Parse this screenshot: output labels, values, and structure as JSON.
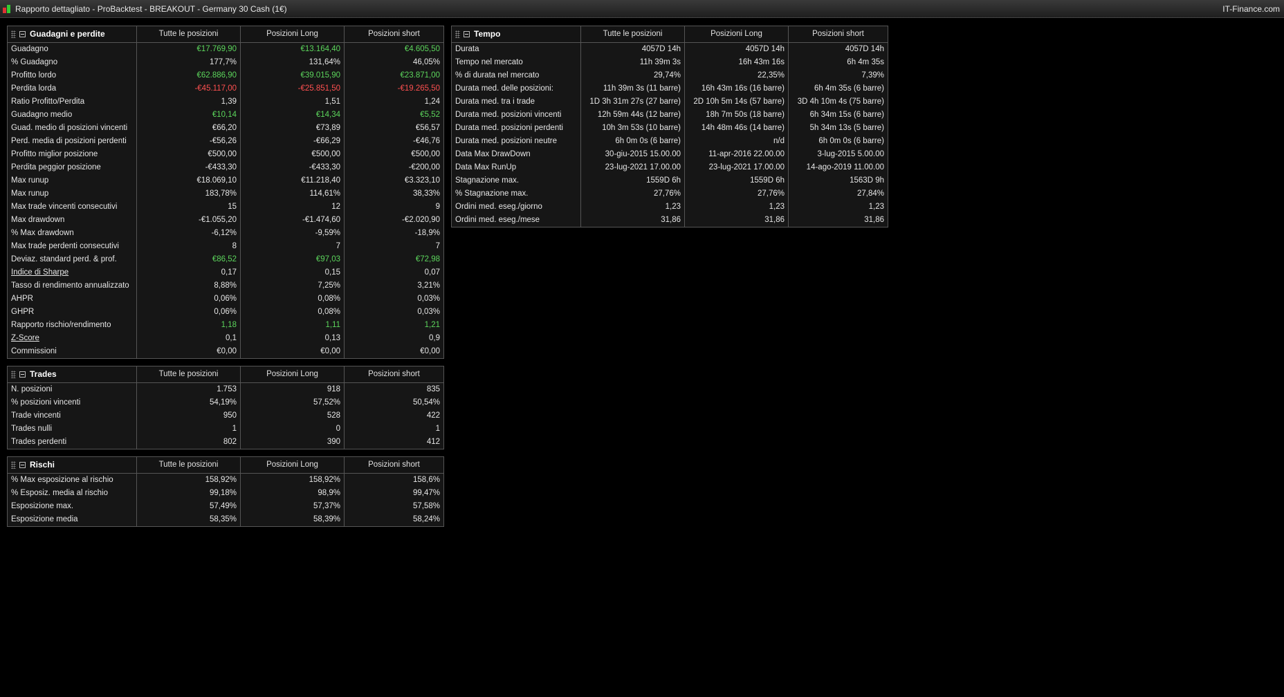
{
  "window": {
    "title": "Rapporto dettagliato - ProBacktest - BREAKOUT - Germany 30 Cash (1€)",
    "brand": "IT-Finance.com"
  },
  "colors": {
    "positive": "#5cd65c",
    "negative": "#ff5050",
    "background": "#000000"
  },
  "columns": [
    "Tutte le posizioni",
    "Posizioni Long",
    "Posizioni short"
  ],
  "panels": {
    "guadagni": {
      "title": "Guadagni e perdite",
      "rows": [
        {
          "label": "Guadagno",
          "values": [
            "€17.769,90",
            "€13.164,40",
            "€4.605,50"
          ],
          "style": "pos"
        },
        {
          "label": "% Guadagno",
          "values": [
            "177,7%",
            "131,64%",
            "46,05%"
          ]
        },
        {
          "label": "Profitto lordo",
          "values": [
            "€62.886,90",
            "€39.015,90",
            "€23.871,00"
          ],
          "style": "pos"
        },
        {
          "label": "Perdita lorda",
          "values": [
            "-€45.117,00",
            "-€25.851,50",
            "-€19.265,50"
          ],
          "style": "neg"
        },
        {
          "label": "Ratio Profitto/Perdita",
          "values": [
            "1,39",
            "1,51",
            "1,24"
          ]
        },
        {
          "label": "Guadagno medio",
          "values": [
            "€10,14",
            "€14,34",
            "€5,52"
          ],
          "style": "pos"
        },
        {
          "label": "Guad. medio di posizioni vincenti",
          "values": [
            "€66,20",
            "€73,89",
            "€56,57"
          ]
        },
        {
          "label": "Perd. media di posizioni perdenti",
          "values": [
            "-€56,26",
            "-€66,29",
            "-€46,76"
          ]
        },
        {
          "label": "Profitto miglior posizione",
          "values": [
            "€500,00",
            "€500,00",
            "€500,00"
          ]
        },
        {
          "label": "Perdita peggior posizione",
          "values": [
            "-€433,30",
            "-€433,30",
            "-€200,00"
          ]
        },
        {
          "label": "Max runup",
          "values": [
            "€18.069,10",
            "€11.218,40",
            "€3.323,10"
          ]
        },
        {
          "label": "Max runup",
          "values": [
            "183,78%",
            "114,61%",
            "38,33%"
          ]
        },
        {
          "label": "Max trade vincenti consecutivi",
          "values": [
            "15",
            "12",
            "9"
          ]
        },
        {
          "label": "Max drawdown",
          "values": [
            "-€1.055,20",
            "-€1.474,60",
            "-€2.020,90"
          ]
        },
        {
          "label": "% Max drawdown",
          "values": [
            "-6,12%",
            "-9,59%",
            "-18,9%"
          ]
        },
        {
          "label": "Max trade perdenti consecutivi",
          "values": [
            "8",
            "7",
            "7"
          ]
        },
        {
          "label": "Deviaz. standard perd. & prof.",
          "values": [
            "€86,52",
            "€97,03",
            "€72,98"
          ],
          "style": "pos"
        },
        {
          "label": "Indice di Sharpe",
          "values": [
            "0,17",
            "0,15",
            "0,07"
          ],
          "underline": true
        },
        {
          "label": "Tasso di rendimento annualizzato",
          "values": [
            "8,88%",
            "7,25%",
            "3,21%"
          ]
        },
        {
          "label": "AHPR",
          "values": [
            "0,06%",
            "0,08%",
            "0,03%"
          ]
        },
        {
          "label": "GHPR",
          "values": [
            "0,06%",
            "0,08%",
            "0,03%"
          ]
        },
        {
          "label": "Rapporto rischio/rendimento",
          "values": [
            "1,18",
            "1,11",
            "1,21"
          ],
          "style": "pos"
        },
        {
          "label": "Z-Score",
          "values": [
            "0,1",
            "0,13",
            "0,9"
          ],
          "underline": true
        },
        {
          "label": "Commissioni",
          "values": [
            "€0,00",
            "€0,00",
            "€0,00"
          ]
        }
      ]
    },
    "trades": {
      "title": "Trades",
      "rows": [
        {
          "label": "N. posizioni",
          "values": [
            "1.753",
            "918",
            "835"
          ]
        },
        {
          "label": "% posizioni vincenti",
          "values": [
            "54,19%",
            "57,52%",
            "50,54%"
          ]
        },
        {
          "label": "Trade vincenti",
          "values": [
            "950",
            "528",
            "422"
          ]
        },
        {
          "label": "Trades nulli",
          "values": [
            "1",
            "0",
            "1"
          ]
        },
        {
          "label": "Trades perdenti",
          "values": [
            "802",
            "390",
            "412"
          ]
        }
      ]
    },
    "rischi": {
      "title": "Rischi",
      "rows": [
        {
          "label": "% Max esposizione al rischio",
          "values": [
            "158,92%",
            "158,92%",
            "158,6%"
          ]
        },
        {
          "label": "% Esposiz. media al rischio",
          "values": [
            "99,18%",
            "98,9%",
            "99,47%"
          ]
        },
        {
          "label": "Esposizione max.",
          "values": [
            "57,49%",
            "57,37%",
            "57,58%"
          ]
        },
        {
          "label": "Esposizione media",
          "values": [
            "58,35%",
            "58,39%",
            "58,24%"
          ]
        }
      ]
    },
    "tempo": {
      "title": "Tempo",
      "rows": [
        {
          "label": "Durata",
          "values": [
            "4057D 14h",
            "4057D 14h",
            "4057D 14h"
          ]
        },
        {
          "label": "Tempo nel mercato",
          "values": [
            "11h 39m 3s",
            "16h 43m 16s",
            "6h 4m 35s"
          ]
        },
        {
          "label": "% di durata nel mercato",
          "values": [
            "29,74%",
            "22,35%",
            "7,39%"
          ]
        },
        {
          "label": "Durata med. delle posizioni:",
          "values": [
            "11h 39m 3s (11 barre)",
            "16h 43m 16s (16 barre)",
            "6h 4m 35s (6 barre)"
          ]
        },
        {
          "label": "Durata med. tra i trade",
          "values": [
            "1D 3h 31m 27s (27 barre)",
            "2D 10h 5m 14s (57 barre)",
            "3D 4h 10m 4s (75 barre)"
          ]
        },
        {
          "label": "Durata med. posizioni vincenti",
          "values": [
            "12h 59m 44s (12 barre)",
            "18h 7m 50s (18 barre)",
            "6h 34m 15s (6 barre)"
          ]
        },
        {
          "label": "Durata med. posizioni perdenti",
          "values": [
            "10h 3m 53s (10 barre)",
            "14h 48m 46s (14 barre)",
            "5h 34m 13s (5 barre)"
          ]
        },
        {
          "label": "Durata med. posizioni neutre",
          "values": [
            "6h 0m 0s (6 barre)",
            "n/d",
            "6h 0m 0s (6 barre)"
          ]
        },
        {
          "label": "Data Max DrawDown",
          "values": [
            "30-giu-2015 15.00.00",
            "11-apr-2016 22.00.00",
            "3-lug-2015 5.00.00"
          ]
        },
        {
          "label": "Data Max RunUp",
          "values": [
            "23-lug-2021 17.00.00",
            "23-lug-2021 17.00.00",
            "14-ago-2019 11.00.00"
          ]
        },
        {
          "label": "Stagnazione max.",
          "values": [
            "1559D 6h",
            "1559D 6h",
            "1563D 9h"
          ]
        },
        {
          "label": "% Stagnazione max.",
          "values": [
            "27,76%",
            "27,76%",
            "27,84%"
          ]
        },
        {
          "label": "Ordini med. eseg./giorno",
          "values": [
            "1,23",
            "1,23",
            "1,23"
          ]
        },
        {
          "label": "Ordini med. eseg./mese",
          "values": [
            "31,86",
            "31,86",
            "31,86"
          ]
        }
      ]
    }
  }
}
